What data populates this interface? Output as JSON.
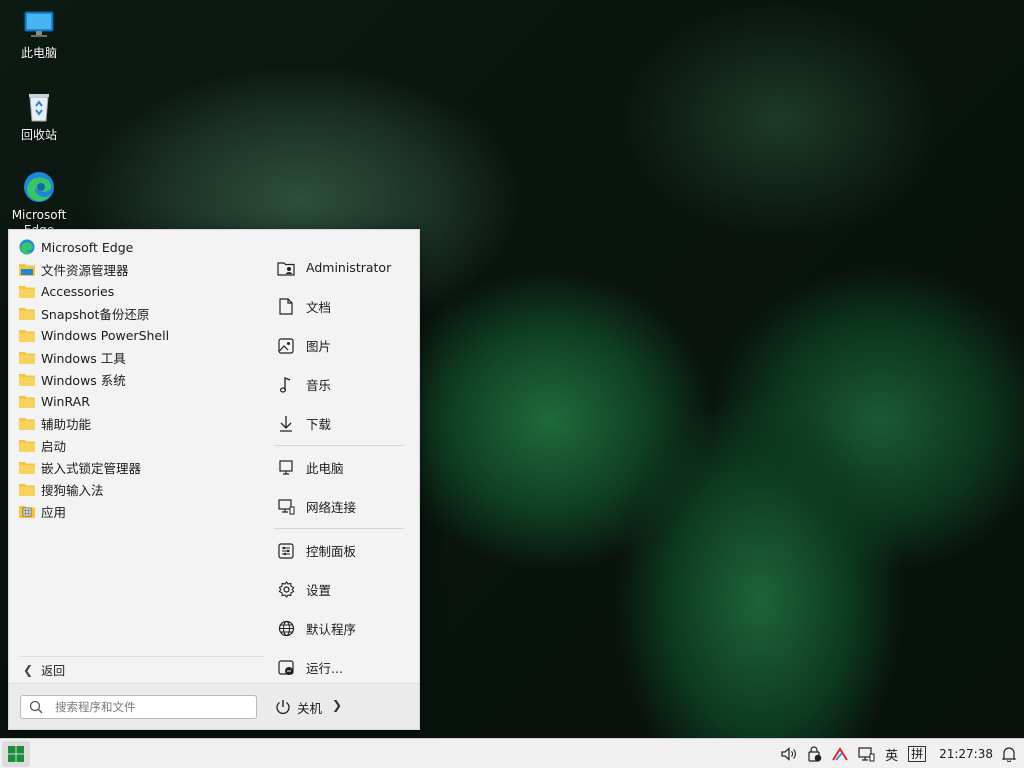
{
  "desktop": {
    "icons": [
      {
        "label": "此电脑",
        "icon": "computer-icon"
      },
      {
        "label": "回收站",
        "icon": "recycle-bin-icon"
      },
      {
        "label": "Microsoft Edge",
        "icon": "edge-icon"
      }
    ]
  },
  "start_menu": {
    "programs": [
      {
        "label": "Microsoft Edge",
        "icon": "edge-icon"
      },
      {
        "label": "文件资源管理器",
        "icon": "file-explorer-icon"
      },
      {
        "label": "Accessories",
        "icon": "folder-icon"
      },
      {
        "label": "Snapshot备份还原",
        "icon": "folder-icon"
      },
      {
        "label": "Windows PowerShell",
        "icon": "folder-icon"
      },
      {
        "label": "Windows 工具",
        "icon": "folder-icon"
      },
      {
        "label": "Windows 系统",
        "icon": "folder-icon"
      },
      {
        "label": "WinRAR",
        "icon": "folder-icon"
      },
      {
        "label": "辅助功能",
        "icon": "folder-icon"
      },
      {
        "label": "启动",
        "icon": "folder-icon"
      },
      {
        "label": "嵌入式锁定管理器",
        "icon": "folder-icon"
      },
      {
        "label": "搜狗输入法",
        "icon": "folder-icon"
      },
      {
        "label": "应用",
        "icon": "apps-folder-icon"
      }
    ],
    "back_label": "返回",
    "places": [
      {
        "label": "Administrator",
        "icon": "user-folder-icon"
      },
      {
        "label": "文档",
        "icon": "document-icon"
      },
      {
        "label": "图片",
        "icon": "picture-icon"
      },
      {
        "label": "音乐",
        "icon": "music-icon"
      },
      {
        "label": "下载",
        "icon": "download-icon"
      },
      {
        "label": "此电脑",
        "icon": "computer-icon"
      },
      {
        "label": "网络连接",
        "icon": "network-icon"
      },
      {
        "label": "控制面板",
        "icon": "control-panel-icon"
      },
      {
        "label": "设置",
        "icon": "gear-icon"
      },
      {
        "label": "默认程序",
        "icon": "globe-icon"
      },
      {
        "label": "运行...",
        "icon": "run-icon"
      }
    ],
    "search_placeholder": "搜索程序和文件",
    "power_label": "关机"
  },
  "taskbar": {
    "tray": {
      "ime_mode": "英",
      "ime_layout": "拼",
      "time": "21:27:38"
    }
  },
  "colors": {
    "accent": "#1e8a3c",
    "folder": "#f5c542",
    "menu_bg": "#f3f3f3"
  }
}
